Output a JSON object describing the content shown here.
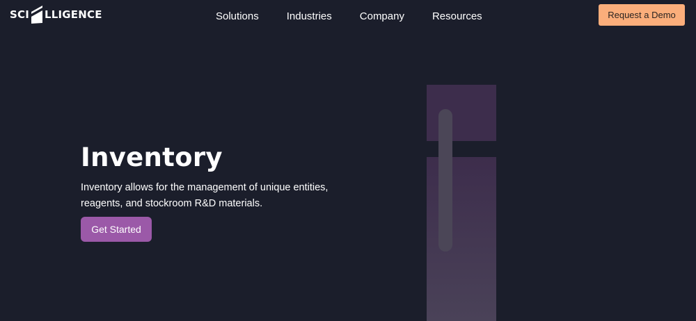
{
  "header": {
    "logo": {
      "text_left": "SCI",
      "text_right": "LLIGENCE"
    },
    "nav": [
      {
        "label": "Solutions"
      },
      {
        "label": "Industries"
      },
      {
        "label": "Company"
      },
      {
        "label": "Resources"
      }
    ],
    "demo_button_label": "Request a Demo"
  },
  "hero": {
    "title": "Inventory",
    "description": "Inventory allows for the management of unique entities, reagents, and stockroom R&D materials.",
    "cta_label": "Get Started"
  },
  "colors": {
    "background": "#1b1e2b",
    "demo_button": "#fbae7b",
    "cta_button": "#9b59a8",
    "graphic_block": "#3d2d4c",
    "graphic_pill": "#4b4657"
  }
}
